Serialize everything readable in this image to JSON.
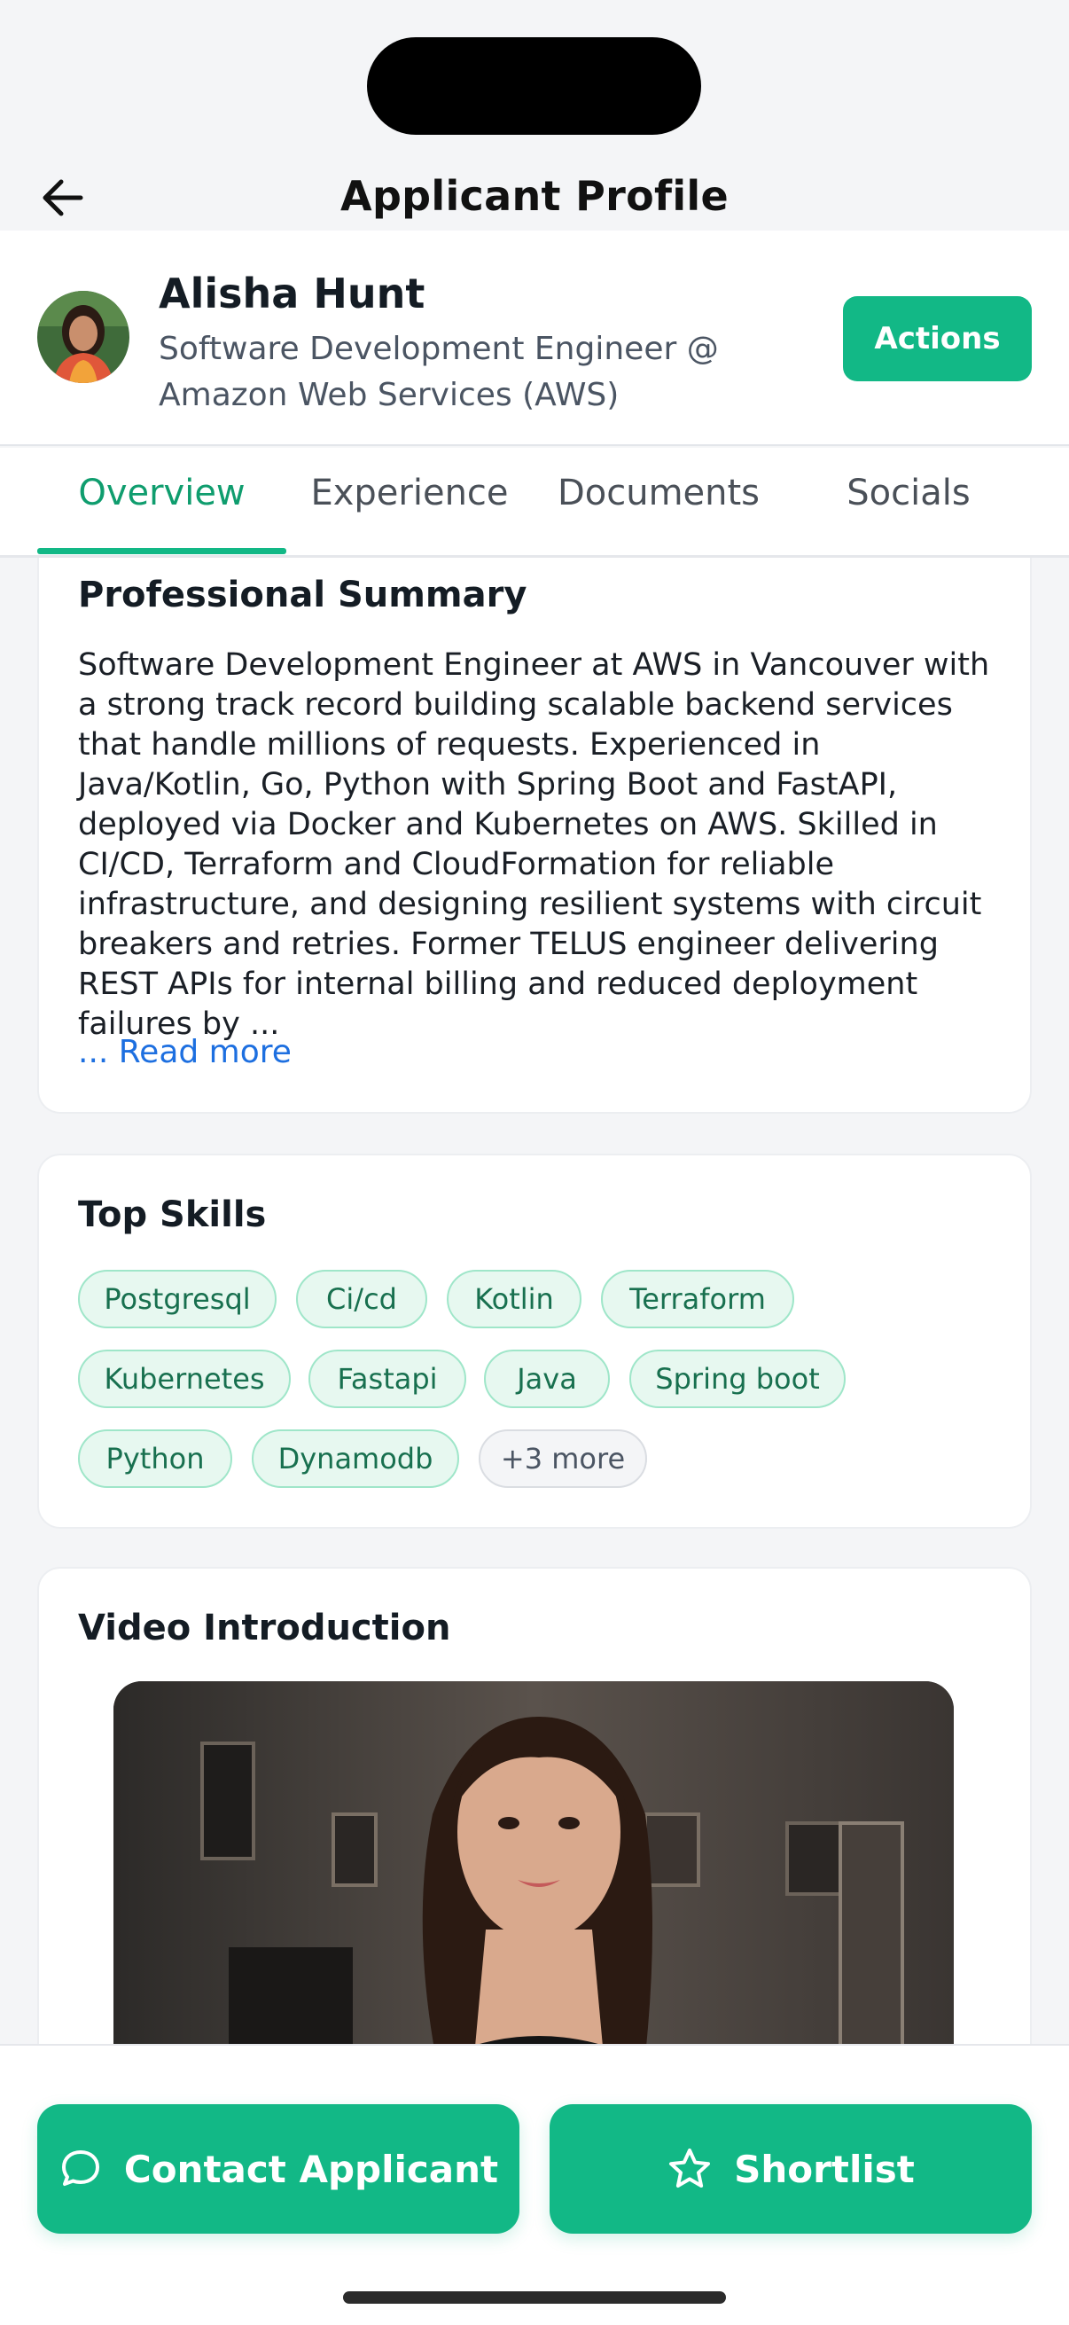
{
  "nav": {
    "title": "Applicant Profile",
    "back_icon": "arrow-left-icon"
  },
  "profile": {
    "name": "Alisha Hunt",
    "role": "Software Development Engineer @ Amazon Web Services (AWS)",
    "actions_label": "Actions"
  },
  "tabs": [
    {
      "label": "Overview",
      "active": true
    },
    {
      "label": "Experience",
      "active": false
    },
    {
      "label": "Documents",
      "active": false
    },
    {
      "label": "Socials",
      "active": false
    }
  ],
  "summary": {
    "title": "Professional Summary",
    "text": "Software Development Engineer at AWS in Vancouver with a strong track record building scalable backend services that handle millions of requests. Experienced in Java/Kotlin, Go, Python with Spring Boot and FastAPI, deployed via Docker and Kubernetes on AWS. Skilled in CI/CD, Terraform and CloudFormation for reliable infrastructure, and designing resilient systems with circuit breakers and retries. Former TELUS engineer delivering REST APIs for internal billing and reduced deployment failures by ...",
    "read_more": "... Read more"
  },
  "skills": {
    "title": "Top Skills",
    "items": [
      "Postgresql",
      "Ci/cd",
      "Kotlin",
      "Terraform",
      "Kubernetes",
      "Fastapi",
      "Java",
      "Spring boot",
      "Python",
      "Dynamodb"
    ],
    "more_label": "+3 more"
  },
  "video": {
    "title": "Video Introduction"
  },
  "bottom": {
    "contact_label": "Contact Applicant",
    "contact_icon": "chat-bubble-icon",
    "shortlist_label": "Shortlist",
    "shortlist_icon": "star-icon"
  },
  "colors": {
    "accent": "#12b886",
    "accent_dark": "#0f9d6e",
    "link": "#1d6fe0",
    "chip_bg": "#e7f8f0",
    "chip_border": "#9fe6c9"
  }
}
